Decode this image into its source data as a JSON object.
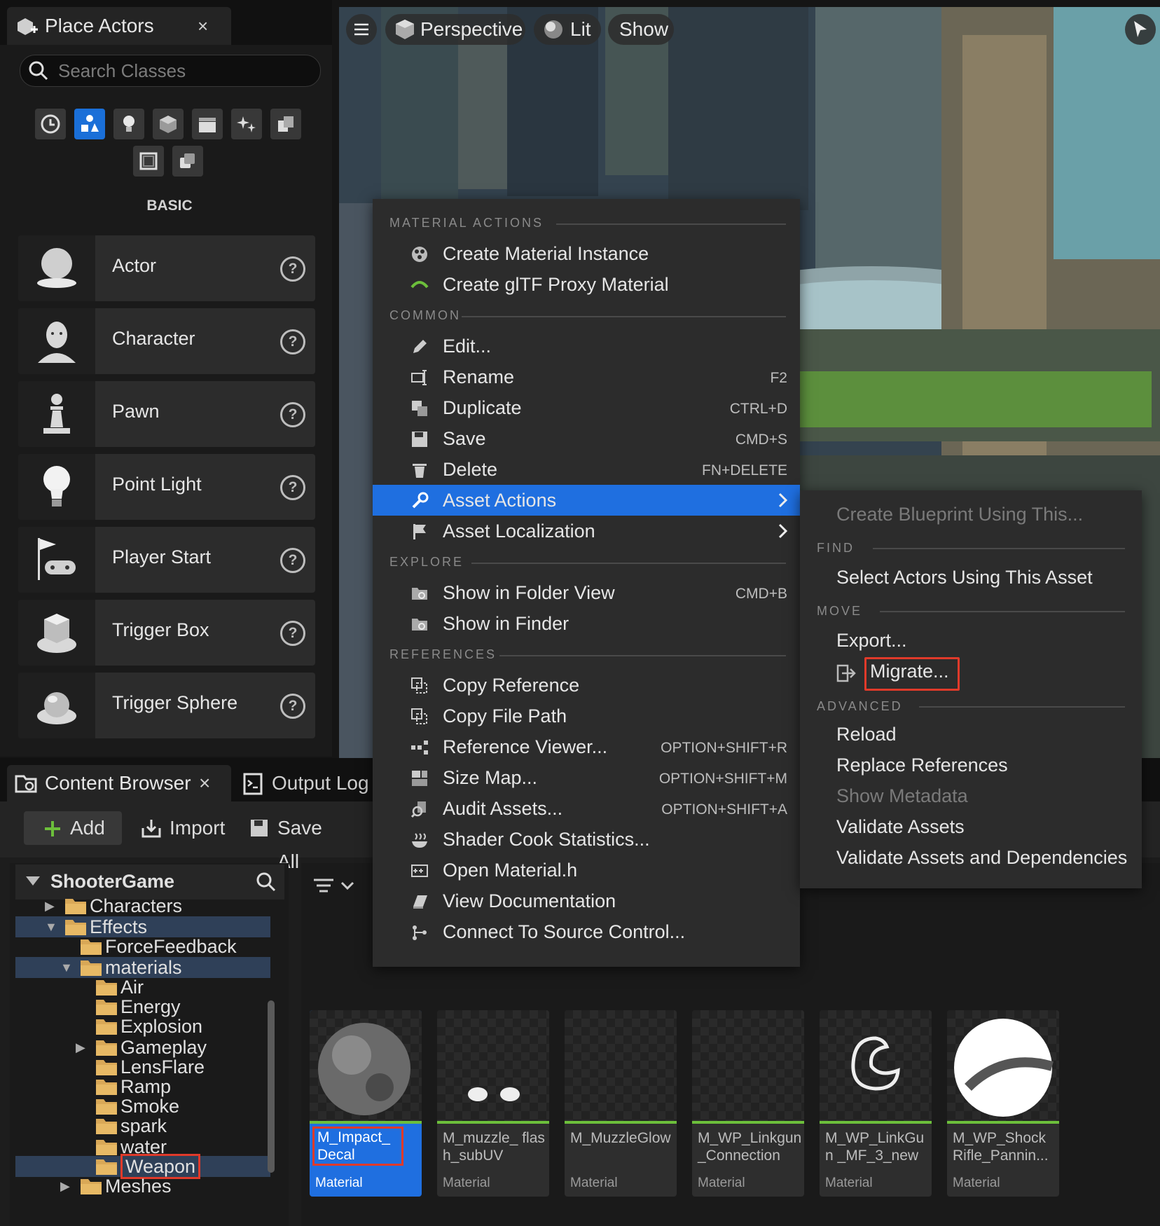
{
  "place_actors": {
    "tab_label": "Place Actors",
    "tab_close": "×",
    "search_placeholder": "Search Classes",
    "category_icons": [
      "clock-icon",
      "shapes-icon",
      "light-bulb-icon",
      "cube-icon",
      "clapperboard-icon",
      "sparkles-icon",
      "layers-icon",
      "volume-icon",
      "copy-icon"
    ],
    "selected_category": "shapes-icon",
    "section_label": "BASIC",
    "actors": [
      {
        "name": "Actor",
        "icon": "sphere-on-base-icon"
      },
      {
        "name": "Character",
        "icon": "character-head-icon"
      },
      {
        "name": "Pawn",
        "icon": "pawn-icon"
      },
      {
        "name": "Point Light",
        "icon": "light-bulb-icon"
      },
      {
        "name": "Player Start",
        "icon": "flag-gamepad-icon"
      },
      {
        "name": "Trigger Box",
        "icon": "trigger-box-icon"
      },
      {
        "name": "Trigger Sphere",
        "icon": "trigger-sphere-icon"
      }
    ],
    "help_glyph": "?"
  },
  "viewport": {
    "perspective_label": "Perspective",
    "lit_label": "Lit",
    "show_label": "Show"
  },
  "content_browser": {
    "tab_label": "Content Browser",
    "tab_close": "×",
    "output_log_label": "Output Log",
    "add_label": "Add",
    "import_label": "Import",
    "save_all_label": "Save All",
    "tree_root": "ShooterGame",
    "tree": [
      {
        "label": "Characters",
        "depth": 1,
        "arrow": "▶"
      },
      {
        "label": "Effects",
        "depth": 1,
        "arrow": "▼",
        "selected": true
      },
      {
        "label": "ForceFeedback",
        "depth": 2,
        "arrow": ""
      },
      {
        "label": "materials",
        "depth": 2,
        "arrow": "▼",
        "selected": true
      },
      {
        "label": "Air",
        "depth": 3,
        "arrow": ""
      },
      {
        "label": "Energy",
        "depth": 3,
        "arrow": ""
      },
      {
        "label": "Explosion",
        "depth": 3,
        "arrow": ""
      },
      {
        "label": "Gameplay",
        "depth": 3,
        "arrow": "▶"
      },
      {
        "label": "LensFlare",
        "depth": 3,
        "arrow": ""
      },
      {
        "label": "Ramp",
        "depth": 3,
        "arrow": ""
      },
      {
        "label": "Smoke",
        "depth": 3,
        "arrow": ""
      },
      {
        "label": "spark",
        "depth": 3,
        "arrow": ""
      },
      {
        "label": "water",
        "depth": 3,
        "arrow": ""
      },
      {
        "label": "Weapon",
        "depth": 3,
        "arrow": "",
        "selected": true,
        "outlined": true
      },
      {
        "label": "Meshes",
        "depth": 2,
        "arrow": "▶"
      }
    ],
    "assets": [
      {
        "name": "M_Impact_ Decal",
        "type": "Material",
        "selected": true
      },
      {
        "name": "M_muzzle_ flash_subUV",
        "type": "Material"
      },
      {
        "name": "M_MuzzleGlow",
        "type": "Material"
      },
      {
        "name": "M_WP_Linkgun _Connection",
        "type": "Material"
      },
      {
        "name": "M_WP_LinkGun _MF_3_new",
        "type": "Material"
      },
      {
        "name": "M_WP_Shock Rifle_Pannin...",
        "type": "Material"
      }
    ]
  },
  "context_menu": {
    "sections": [
      {
        "title": "MATERIAL ACTIONS",
        "items": [
          {
            "label": "Create Material Instance",
            "shortcut": "",
            "icon": "material-instance-icon"
          },
          {
            "label": "Create glTF Proxy Material",
            "shortcut": "",
            "icon": "gltf-icon"
          }
        ]
      },
      {
        "title": "COMMON",
        "items": [
          {
            "label": "Edit...",
            "shortcut": "",
            "icon": "pencil-icon"
          },
          {
            "label": "Rename",
            "shortcut": "F2",
            "icon": "rename-icon"
          },
          {
            "label": "Duplicate",
            "shortcut": "CTRL+D",
            "icon": "duplicate-icon"
          },
          {
            "label": "Save",
            "shortcut": "CMD+S",
            "icon": "save-icon"
          },
          {
            "label": "Delete",
            "shortcut": "FN+DELETE",
            "icon": "trash-icon"
          },
          {
            "label": "Asset Actions",
            "shortcut": "",
            "icon": "wrench-icon",
            "submenu": true,
            "highlighted": true
          },
          {
            "label": "Asset Localization",
            "shortcut": "",
            "icon": "flag-icon",
            "submenu": true
          }
        ]
      },
      {
        "title": "EXPLORE",
        "items": [
          {
            "label": "Show in Folder View",
            "shortcut": "CMD+B",
            "icon": "folder-search-icon"
          },
          {
            "label": "Show in Finder",
            "shortcut": "",
            "icon": "folder-search-icon"
          }
        ]
      },
      {
        "title": "REFERENCES",
        "items": [
          {
            "label": "Copy Reference",
            "shortcut": "",
            "icon": "copy-icon"
          },
          {
            "label": "Copy File Path",
            "shortcut": "",
            "icon": "copy-icon"
          },
          {
            "label": "Reference Viewer...",
            "shortcut": "OPTION+SHIFT+R",
            "icon": "reference-viewer-icon"
          },
          {
            "label": "Size Map...",
            "shortcut": "OPTION+SHIFT+M",
            "icon": "size-map-icon"
          },
          {
            "label": "Audit Assets...",
            "shortcut": "OPTION+SHIFT+A",
            "icon": "audit-icon"
          },
          {
            "label": "Shader Cook Statistics...",
            "shortcut": "",
            "icon": "steam-icon"
          },
          {
            "label": "Open Material.h",
            "shortcut": "",
            "icon": "cpp-file-icon"
          },
          {
            "label": "View Documentation",
            "shortcut": "",
            "icon": "book-icon"
          },
          {
            "label": "Connect To Source Control...",
            "shortcut": "",
            "icon": "source-control-icon"
          }
        ]
      }
    ]
  },
  "submenu": {
    "create_blueprint": "Create Blueprint Using This...",
    "find_title": "FIND",
    "select_actors": "Select Actors Using This Asset",
    "move_title": "MOVE",
    "export": "Export...",
    "migrate": "Migrate...",
    "advanced_title": "ADVANCED",
    "reload": "Reload",
    "replace_references": "Replace References",
    "show_metadata": "Show Metadata",
    "validate_assets": "Validate Assets",
    "validate_deps": "Validate Assets and Dependencies"
  },
  "colors": {
    "accent": "#1f6fe0",
    "highlight_outline": "#e03a2a",
    "material_bar": "#6cbf3b"
  }
}
